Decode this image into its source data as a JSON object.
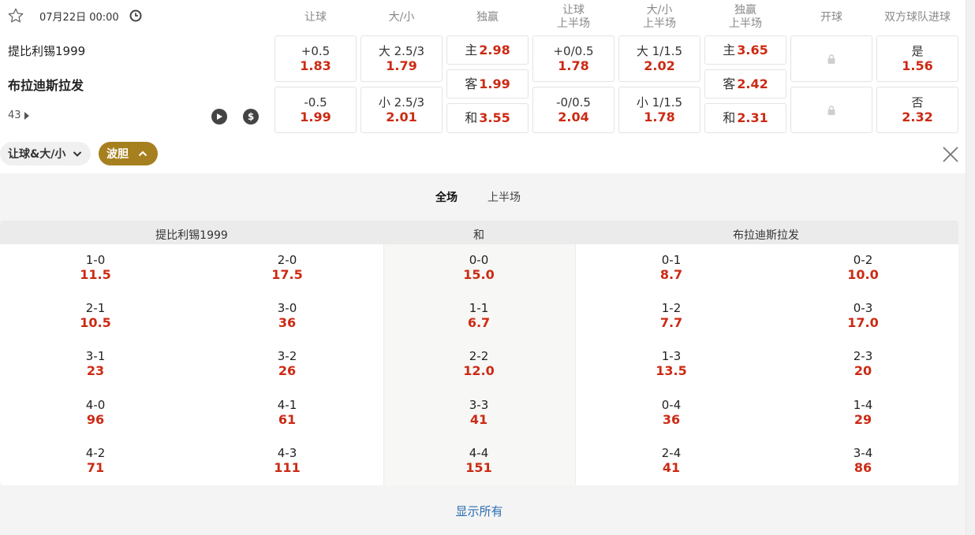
{
  "match": {
    "datetime": "07月22日 00:00",
    "home_team": "提比利锡1999",
    "away_team": "布拉迪斯拉发",
    "more_markets_count": "43"
  },
  "columns": [
    "让球",
    "大/小",
    "独赢",
    "让球\n上半场",
    "大/小\n上半场",
    "独赢\n上半场",
    "开球",
    "双方球队进球"
  ],
  "odds": {
    "handicap": [
      {
        "label": "+0.5",
        "odd": "1.83"
      },
      {
        "label": "-0.5",
        "odd": "1.99"
      }
    ],
    "over_under": [
      {
        "label": "大 2.5/3",
        "odd": "1.79"
      },
      {
        "label": "小 2.5/3",
        "odd": "2.01"
      }
    ],
    "moneyline": [
      {
        "label": "主",
        "odd": "2.98"
      },
      {
        "label": "客",
        "odd": "1.99"
      },
      {
        "label": "和",
        "odd": "3.55"
      }
    ],
    "handicap_1h": [
      {
        "label": "+0/0.5",
        "odd": "1.78"
      },
      {
        "label": "-0/0.5",
        "odd": "2.04"
      }
    ],
    "over_under_1h": [
      {
        "label": "大 1/1.5",
        "odd": "2.02"
      },
      {
        "label": "小 1/1.5",
        "odd": "1.78"
      }
    ],
    "moneyline_1h": [
      {
        "label": "主",
        "odd": "3.65"
      },
      {
        "label": "客",
        "odd": "2.42"
      },
      {
        "label": "和",
        "odd": "2.31"
      }
    ],
    "btts": [
      {
        "label": "是",
        "odd": "1.56"
      },
      {
        "label": "否",
        "odd": "2.32"
      }
    ]
  },
  "filters": {
    "market_select": "让球&大/小",
    "score_toggle": "波胆"
  },
  "panel": {
    "tabs": [
      "全场",
      "上半场"
    ],
    "headers": {
      "home": "提比利锡1999",
      "draw": "和",
      "away": "布拉迪斯拉发"
    },
    "home_col1": [
      {
        "s": "1-0",
        "o": "11.5"
      },
      {
        "s": "2-1",
        "o": "10.5"
      },
      {
        "s": "3-1",
        "o": "23"
      },
      {
        "s": "4-0",
        "o": "96"
      },
      {
        "s": "4-2",
        "o": "71"
      }
    ],
    "home_col2": [
      {
        "s": "2-0",
        "o": "17.5"
      },
      {
        "s": "3-0",
        "o": "36"
      },
      {
        "s": "3-2",
        "o": "26"
      },
      {
        "s": "4-1",
        "o": "61"
      },
      {
        "s": "4-3",
        "o": "111"
      }
    ],
    "draw_col": [
      {
        "s": "0-0",
        "o": "15.0"
      },
      {
        "s": "1-1",
        "o": "6.7"
      },
      {
        "s": "2-2",
        "o": "12.0"
      },
      {
        "s": "3-3",
        "o": "41"
      },
      {
        "s": "4-4",
        "o": "151"
      }
    ],
    "away_col1": [
      {
        "s": "0-1",
        "o": "8.7"
      },
      {
        "s": "1-2",
        "o": "7.7"
      },
      {
        "s": "1-3",
        "o": "13.5"
      },
      {
        "s": "0-4",
        "o": "36"
      },
      {
        "s": "2-4",
        "o": "41"
      }
    ],
    "away_col2": [
      {
        "s": "0-2",
        "o": "10.0"
      },
      {
        "s": "0-3",
        "o": "17.0"
      },
      {
        "s": "2-3",
        "o": "20"
      },
      {
        "s": "1-4",
        "o": "29"
      },
      {
        "s": "3-4",
        "o": "86"
      }
    ],
    "show_all": "显示所有"
  },
  "colors": {
    "odd_red": "#cc2a14",
    "toggle_gold": "#a6801e",
    "link_blue": "#2a6cb3"
  }
}
